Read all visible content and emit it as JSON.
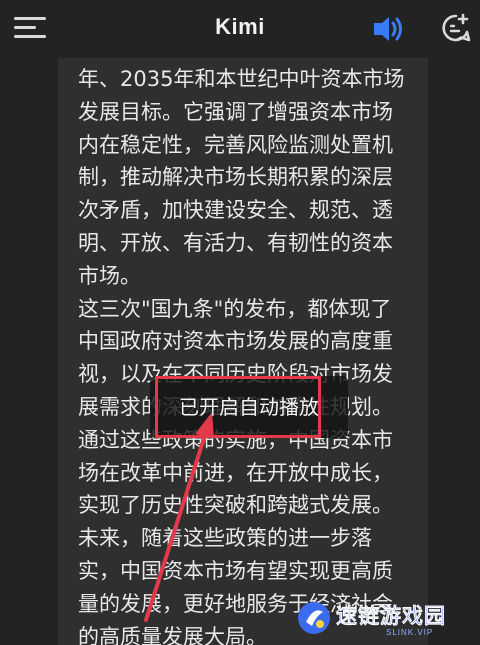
{
  "app": {
    "title": "Kimi"
  },
  "topbar": {
    "menu_icon": "hamburger-menu-icon",
    "speaker_icon": "speaker-icon",
    "new_chat_icon": "new-chat-icon",
    "speaker_color": "#3a7bfd"
  },
  "message": {
    "lines": [
      "年、2035年和本世纪中叶资本市场",
      "发展目标。它强调了增强资本市场",
      "内在稳定性，完善风险监测处置机",
      "制，推动解决市场长期积累的深层",
      "次矛盾，加快建设安全、规范、透",
      "明、开放、有活力、有韧性的资本",
      "市场。",
      "这三次\"国九条\"的发布，都体现了",
      "中国政府对资本市场发展的高度重",
      "视，以及在不同历史阶段对市场发",
      "展需求的深刻理解和前瞻性规划。",
      "通过这些政策的实施，中国资本市",
      "场在改革中前进，在开放中成长，",
      "实现了历史性突破和跨越式发展。",
      "未来，随着这些政策的进一步落",
      "实，中国资本市场有望实现更高质",
      "量的发展，更好地服务于经济社会",
      "的高质量发展大局。"
    ]
  },
  "toast": {
    "text": "已开启自动播放"
  },
  "annotation": {
    "color": "#e23a4a"
  },
  "watermark": {
    "text": "速链游戏园",
    "sub": "SLINK.VIP",
    "color": "#3b6cf0"
  }
}
